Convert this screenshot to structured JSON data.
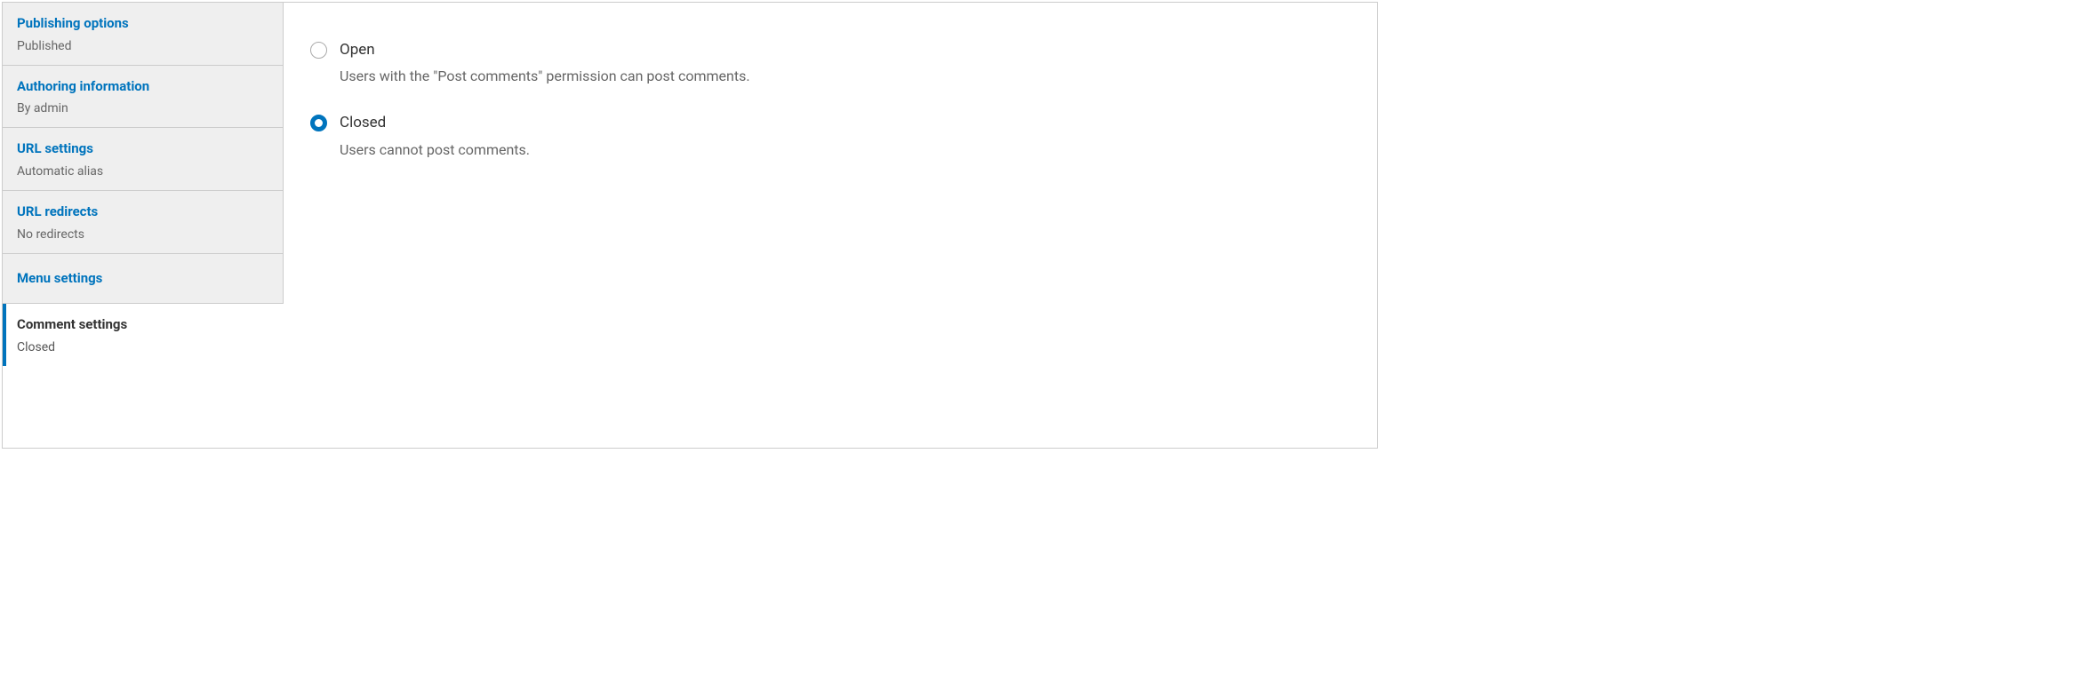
{
  "sidebar": {
    "tabs": [
      {
        "title": "Publishing options",
        "summary": "Published"
      },
      {
        "title": "Authoring information",
        "summary": "By admin"
      },
      {
        "title": "URL settings",
        "summary": "Automatic alias"
      },
      {
        "title": "URL redirects",
        "summary": "No redirects"
      },
      {
        "title": "Menu settings",
        "summary": ""
      },
      {
        "title": "Comment settings",
        "summary": "Closed"
      }
    ]
  },
  "content": {
    "options": [
      {
        "label": "Open",
        "description": "Users with the \"Post comments\" permission can post comments.",
        "checked": false
      },
      {
        "label": "Closed",
        "description": "Users cannot post comments.",
        "checked": true
      }
    ]
  }
}
